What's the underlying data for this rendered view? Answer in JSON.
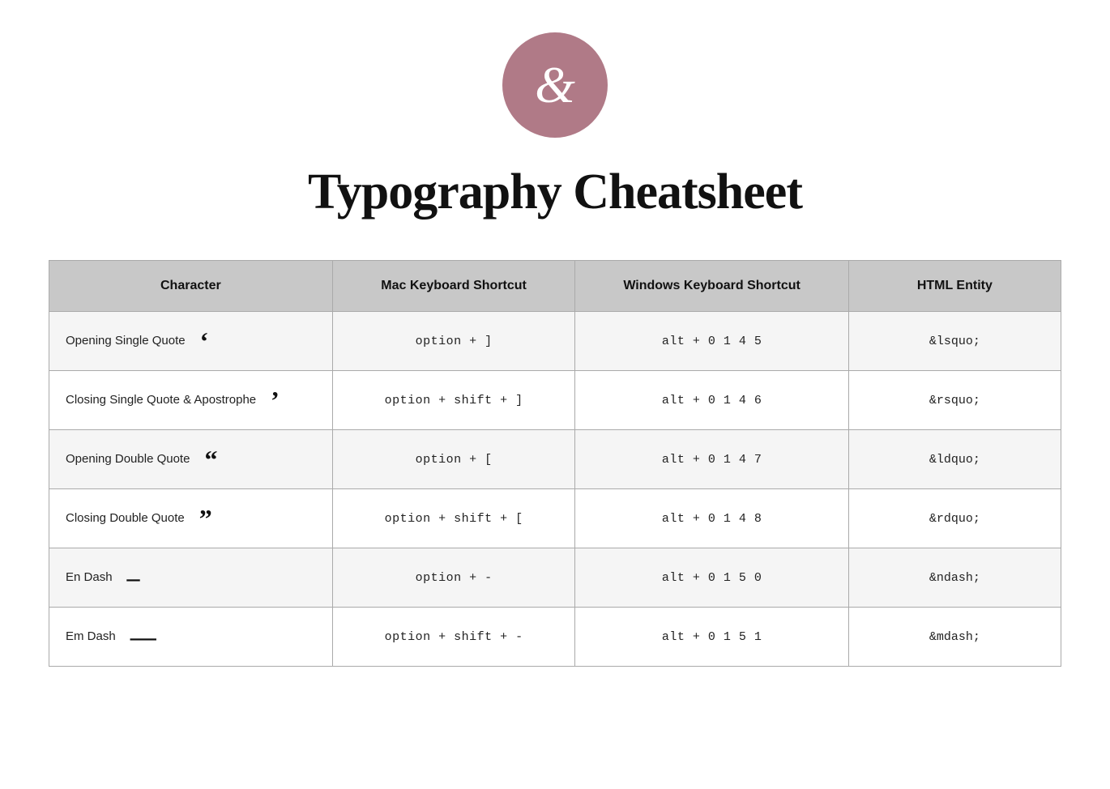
{
  "header": {
    "logo_symbol": "&",
    "title": "Typography Cheatsheet"
  },
  "table": {
    "columns": [
      "Character",
      "Mac Keyboard Shortcut",
      "Windows Keyboard Shortcut",
      "HTML Entity"
    ],
    "rows": [
      {
        "name": "Opening Single Quote",
        "glyph": "‘",
        "mac": "option + ]",
        "windows": "alt + 0 1 4 5",
        "html": "&lsquo;"
      },
      {
        "name": "Closing Single Quote & Apostrophe",
        "glyph": "’",
        "mac": "option + shift + ]",
        "windows": "alt + 0 1 4 6",
        "html": "&rsquo;"
      },
      {
        "name": "Opening Double Quote",
        "glyph": "“",
        "mac": "option + [",
        "windows": "alt + 0 1 4 7",
        "html": "&ldquo;"
      },
      {
        "name": "Closing Double Quote",
        "glyph": "”",
        "mac": "option + shift + [",
        "windows": "alt + 0 1 4 8",
        "html": "&rdquo;"
      },
      {
        "name": "En Dash",
        "glyph": "–",
        "mac": "option + -",
        "windows": "alt + 0 1 5 0",
        "html": "&ndash;"
      },
      {
        "name": "Em Dash",
        "glyph": "—",
        "mac": "option + shift + -",
        "windows": "alt + 0 1 5 1",
        "html": "&mdash;"
      }
    ]
  }
}
